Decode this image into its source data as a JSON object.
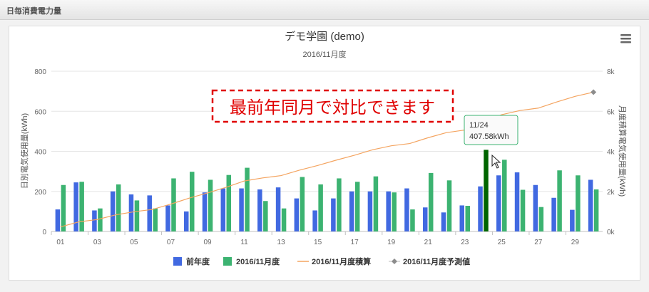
{
  "panel": {
    "title": "日毎消費電力量"
  },
  "chart_data": {
    "type": "bar",
    "title": "デモ学園 (demo)",
    "subtitle": "2016/11月度",
    "ylabel_left": "日別電気使用量(kWh)",
    "ylabel_right": "月度積算電気使用量(kWh)",
    "ylim_left": [
      0,
      800
    ],
    "ylim_right": [
      0,
      8000
    ],
    "left_ticks": [
      "0",
      "200",
      "400",
      "600",
      "800"
    ],
    "right_ticks": [
      "0k",
      "2k",
      "4k",
      "6k",
      "8k"
    ],
    "grid": true,
    "legend_position": "bottom",
    "x_ticks": [
      "01",
      "03",
      "05",
      "07",
      "09",
      "11",
      "13",
      "15",
      "17",
      "19",
      "21",
      "23",
      "25",
      "27",
      "29"
    ],
    "days": 30,
    "series": [
      {
        "name": "前年度",
        "type": "bar",
        "axis": "left",
        "color": "#4169e1",
        "values": [
          110,
          245,
          105,
          200,
          185,
          180,
          130,
          100,
          195,
          215,
          215,
          210,
          220,
          165,
          105,
          165,
          200,
          200,
          200,
          215,
          120,
          95,
          130,
          225,
          280,
          295,
          232,
          168,
          108,
          258
        ]
      },
      {
        "name": "2016/11月度",
        "type": "bar",
        "axis": "left",
        "color": "#3cb371",
        "highlight_color": "#006400",
        "highlight_day": 24,
        "values": [
          232,
          248,
          115,
          235,
          155,
          115,
          265,
          298,
          258,
          282,
          318,
          152,
          115,
          272,
          235,
          265,
          248,
          275,
          195,
          110,
          292,
          255,
          128,
          407.58,
          358,
          208,
          122,
          305,
          280,
          210
        ]
      },
      {
        "name": "2016/11月度積算",
        "type": "line",
        "axis": "right",
        "color": "#f4a460",
        "values": [
          230,
          480,
          595,
          830,
          985,
          1100,
          1365,
          1663,
          1921,
          2203,
          2521,
          2673,
          2788,
          3060,
          3295,
          3560,
          3808,
          4083,
          4278,
          4388,
          4680,
          4935,
          5063,
          5471,
          5829,
          6037,
          6159,
          6464,
          6744,
          6954
        ]
      },
      {
        "name": "2016/11月度予測値",
        "type": "line",
        "axis": "right",
        "color": "#8c8c8c",
        "marker": "diamond",
        "points": [
          [
            30,
            6954
          ]
        ]
      }
    ],
    "tooltip": {
      "day": 24,
      "line1": "11/24",
      "line2": "407.58kWh"
    },
    "annotation": "最前年同月で対比できます"
  },
  "menu": {
    "icon": "hamburger-menu-icon"
  }
}
